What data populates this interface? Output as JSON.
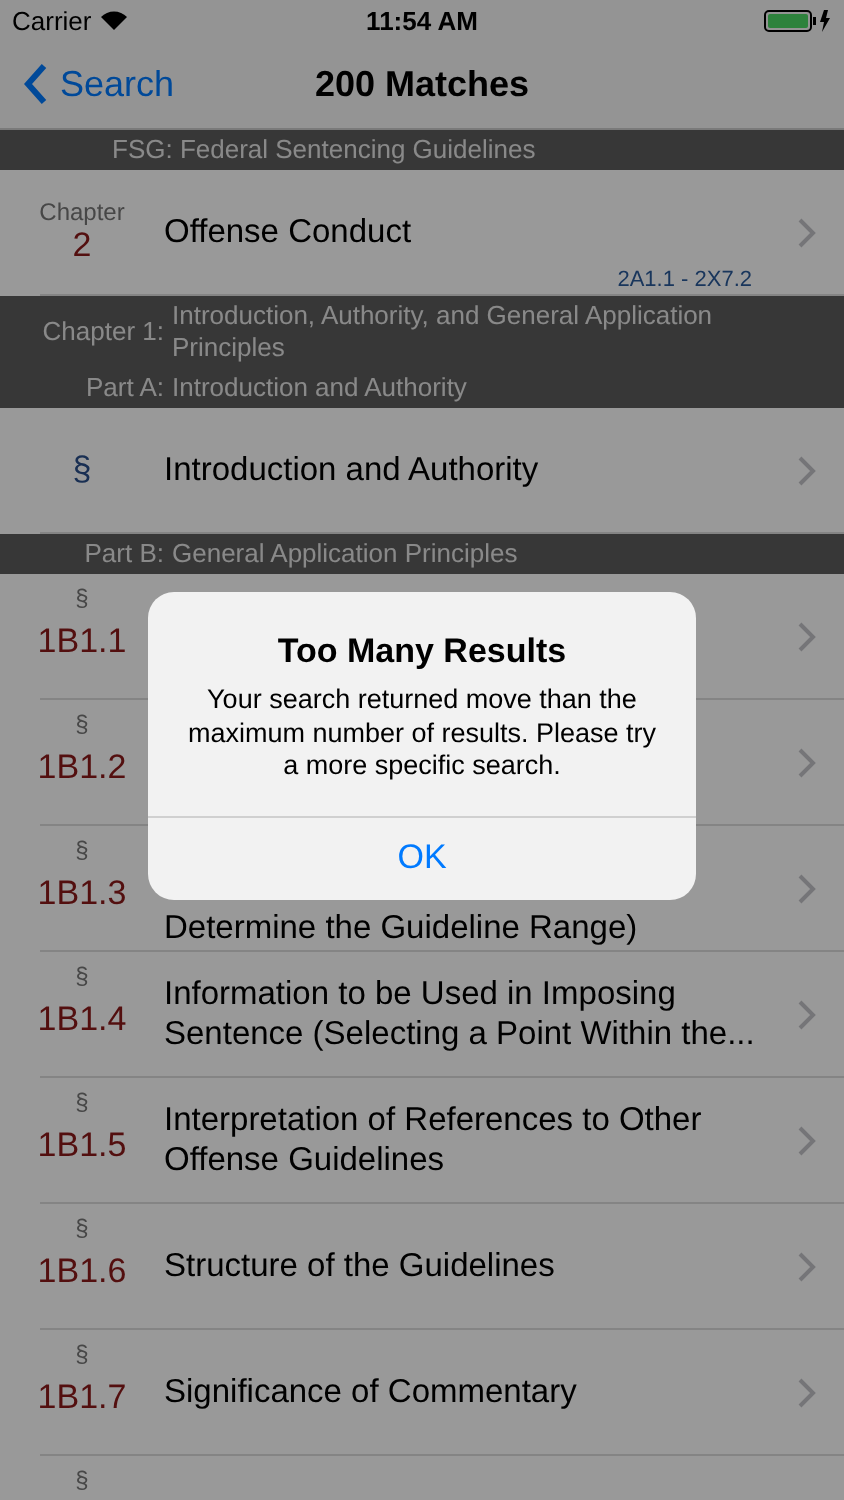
{
  "status_bar": {
    "carrier": "Carrier",
    "time": "11:54 AM"
  },
  "nav": {
    "back": "Search",
    "title": "200 Matches"
  },
  "list": [
    {
      "kind": "header",
      "text": "FSG: Federal Sentencing Guidelines"
    },
    {
      "kind": "chapter",
      "label": "Chapter",
      "number": "2",
      "title": "Offense Conduct",
      "range": "2A1.1 - 2X7.2"
    },
    {
      "kind": "header",
      "prefix": "Chapter 1:",
      "text": "Introduction, Authority, and General Application Principles"
    },
    {
      "kind": "header",
      "prefix": "Part A:",
      "text": "Introduction and Authority"
    },
    {
      "kind": "symbol-row",
      "symbol": "§",
      "title": "Introduction and Authority"
    },
    {
      "kind": "header",
      "prefix": "Part B:",
      "text": "General Application Principles"
    },
    {
      "kind": "section",
      "symbol": "§",
      "number": "1B1.1"
    },
    {
      "kind": "section",
      "symbol": "§",
      "number": "1B1.2"
    },
    {
      "kind": "covered-section",
      "symbol": "§",
      "number": "1B1.3",
      "title": "Determine the Guideline Range)"
    },
    {
      "kind": "section",
      "symbol": "§",
      "number": "1B1.4",
      "title": "Information to be Used in Imposing Sentence (Selecting a Point Within the..."
    },
    {
      "kind": "section",
      "symbol": "§",
      "number": "1B1.5",
      "title": "Interpretation of References to Other Offense Guidelines"
    },
    {
      "kind": "section",
      "symbol": "§",
      "number": "1B1.6",
      "title": "Structure of the Guidelines"
    },
    {
      "kind": "section",
      "symbol": "§",
      "number": "1B1.7",
      "title": "Significance of Commentary"
    },
    {
      "kind": "section",
      "symbol": "§"
    }
  ],
  "alert": {
    "title": "Too Many Results",
    "message": "Your search returned move than the maximum number of results. Please try a more specific search.",
    "button": "OK"
  }
}
